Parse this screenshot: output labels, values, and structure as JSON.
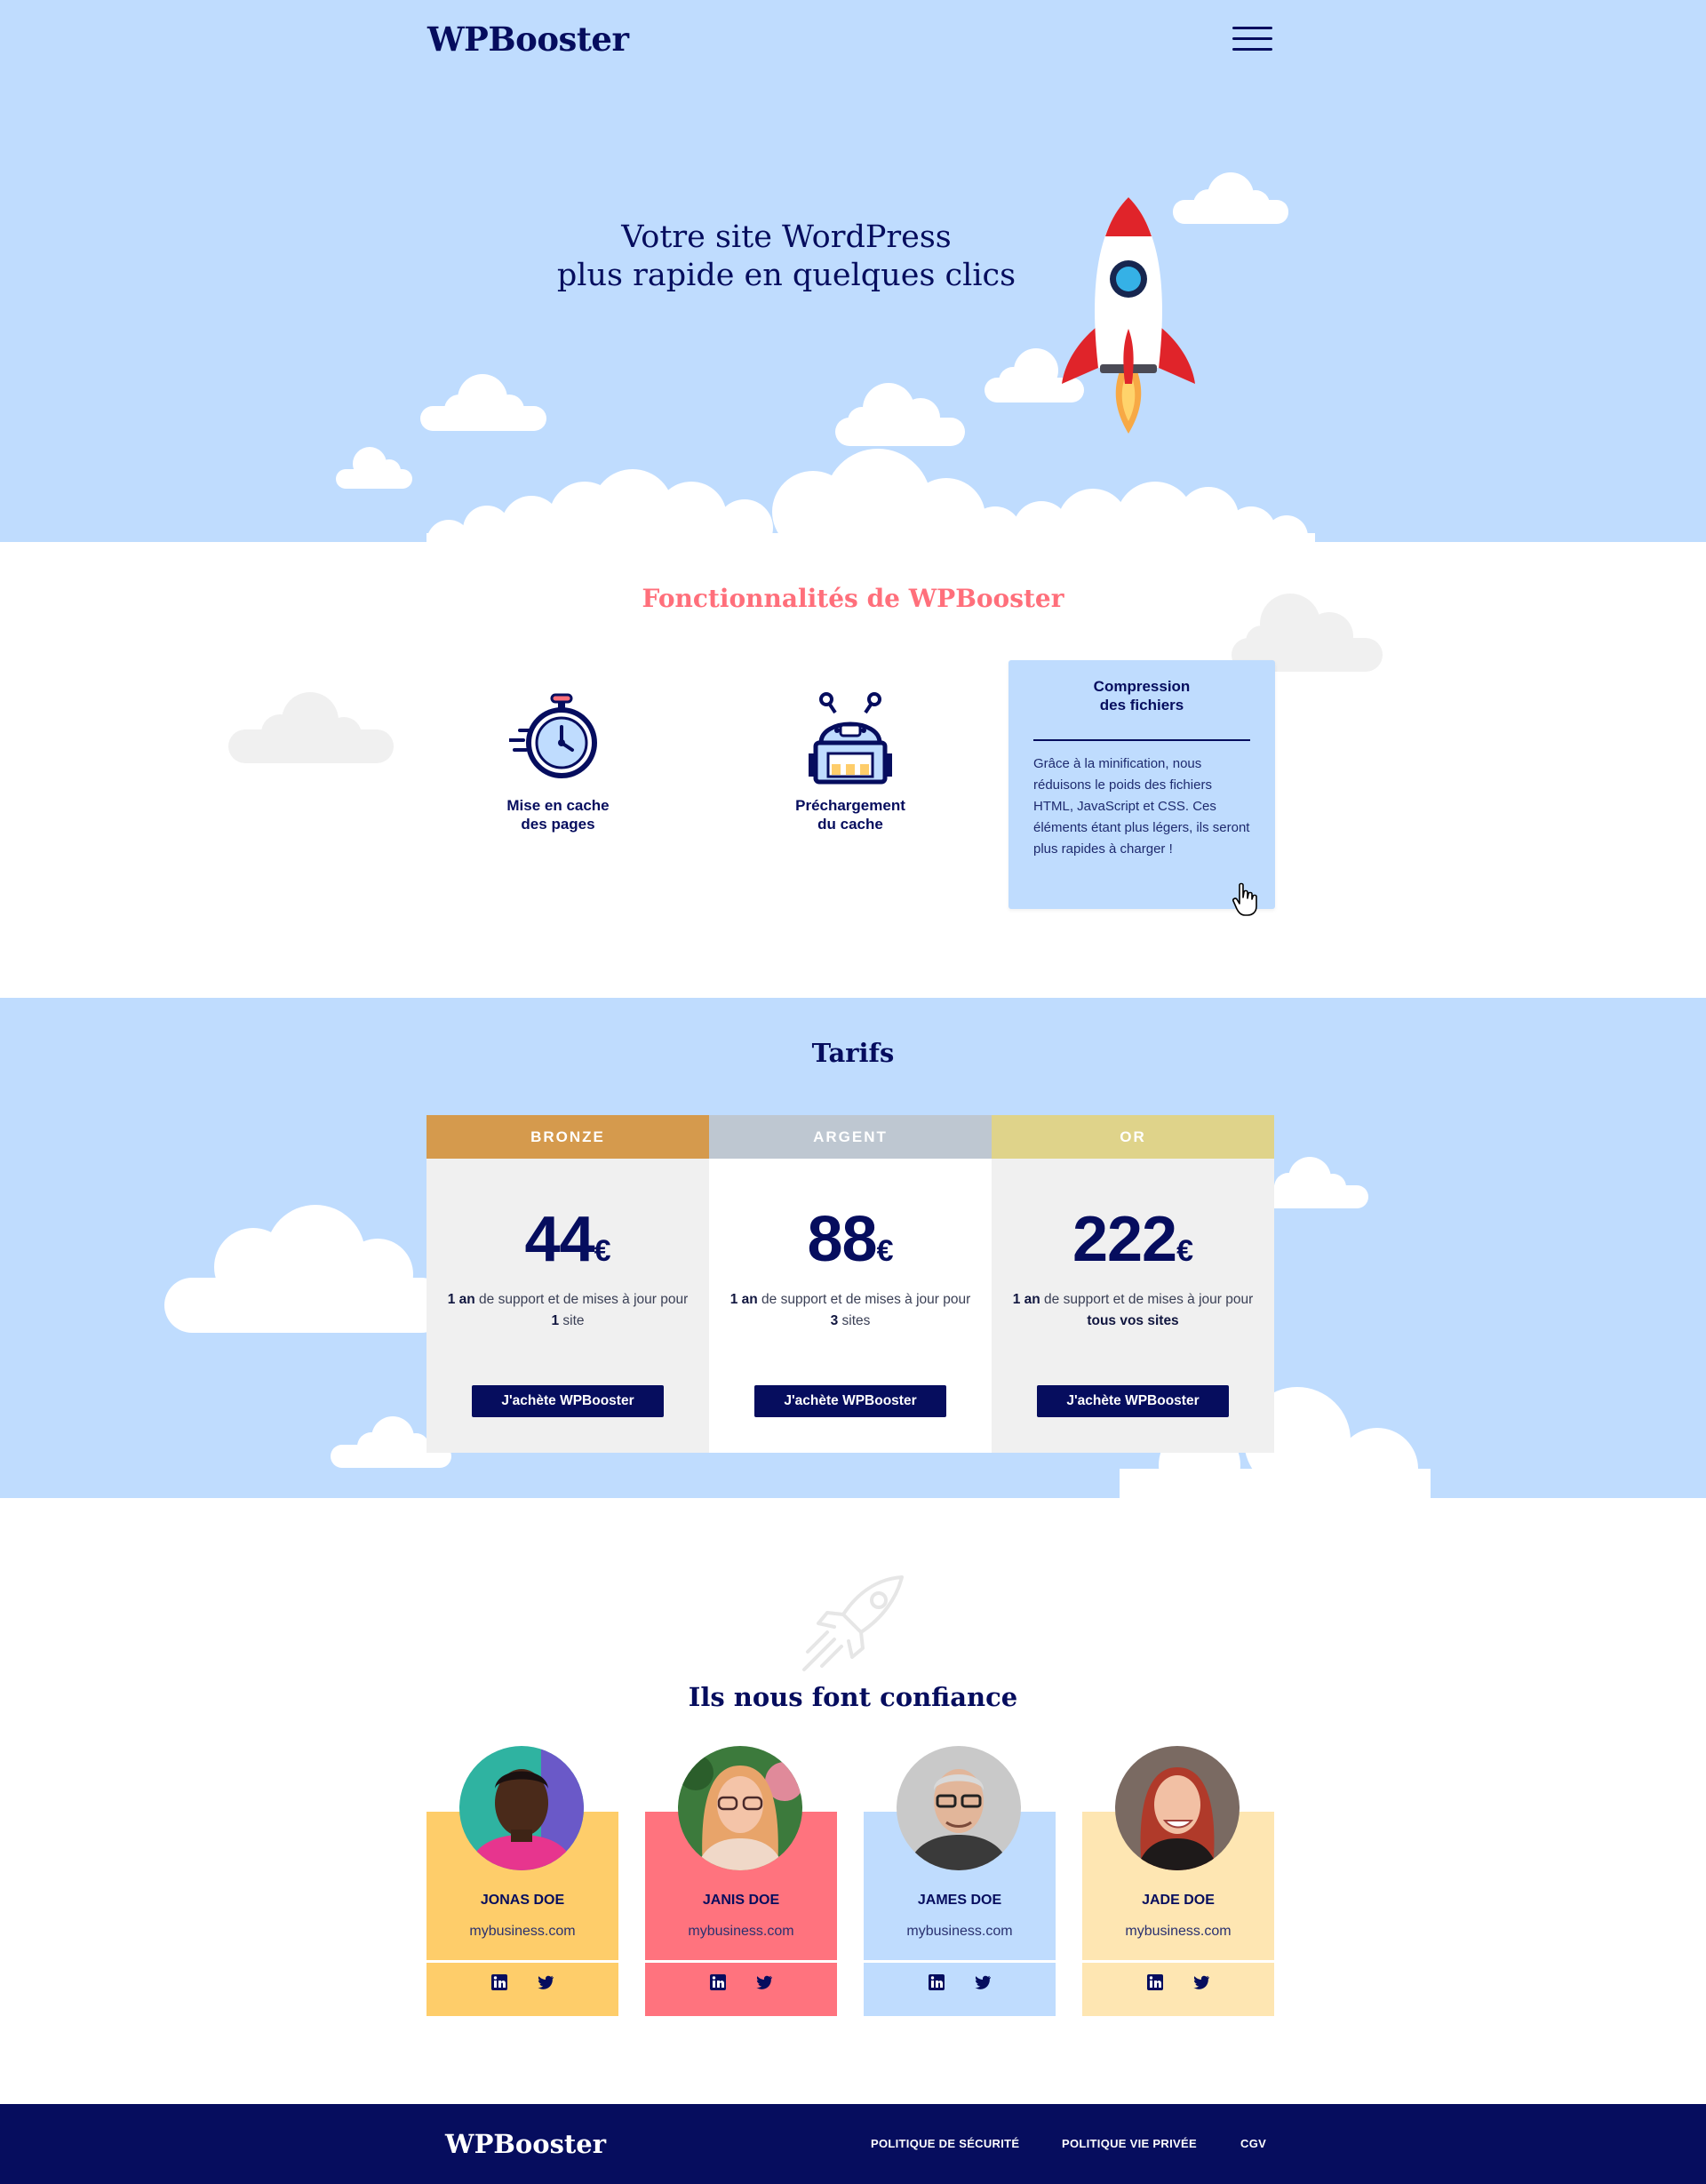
{
  "header": {
    "logo": "WPBooster",
    "menu_icon": "hamburger-menu-icon"
  },
  "hero": {
    "title_line1": "Votre site WordPress",
    "title_line2": "plus rapide en quelques clics",
    "illustration": "rocket-icon"
  },
  "features": {
    "title": "Fonctionnalités de WPBooster",
    "items": [
      {
        "icon": "stopwatch-icon",
        "label": "Mise en cache\ndes pages"
      },
      {
        "icon": "robot-icon",
        "label": "Préchargement\ndu cache"
      }
    ],
    "card": {
      "title": "Compression\ndes fichiers",
      "text": "Grâce à la minification, nous réduisons le poids des fichiers HTML, JavaScript et CSS. Ces éléments étant plus légers, ils seront plus rapides à charger !"
    }
  },
  "pricing": {
    "title": "Tarifs",
    "currency": "€",
    "plans": [
      {
        "name": "BRONZE",
        "price": "44",
        "desc_bold1": "1 an",
        "desc_mid": " de support et de mises à jour pour ",
        "desc_bold2": "1",
        "desc_end": " site",
        "button": "J'achète WPBooster",
        "head_color": "#d59a4d",
        "body_color": "#f0f0f0"
      },
      {
        "name": "ARGENT",
        "price": "88",
        "desc_bold1": "1 an",
        "desc_mid": " de support et de mises à jour pour ",
        "desc_bold2": "3",
        "desc_end": " sites",
        "button": "J'achète WPBooster",
        "head_color": "#bec7d1",
        "body_color": "#ffffff"
      },
      {
        "name": "OR",
        "price": "222",
        "desc_bold1": "1 an",
        "desc_mid": " de support et de mises à jour pour ",
        "desc_bold2": "tous vos sites",
        "desc_end": "",
        "button": "J'achète WPBooster",
        "head_color": "#dfd38a",
        "body_color": "#f0f0f0"
      }
    ]
  },
  "testimonials": {
    "title": "Ils nous font confiance",
    "people": [
      {
        "name": "JONAS DOE",
        "site": "mybusiness.com",
        "color": "#fecd6a"
      },
      {
        "name": "JANIS DOE",
        "site": "mybusiness.com",
        "color": "#ff737e"
      },
      {
        "name": "JAMES DOE",
        "site": "mybusiness.com",
        "color": "#bfdcfe"
      },
      {
        "name": "JADE DOE",
        "site": "mybusiness.com",
        "color": "#fee6b2"
      }
    ]
  },
  "footer": {
    "logo": "WPBooster",
    "links": [
      "POLITIQUE DE SÉCURITÉ",
      "POLITIQUE VIE PRIVÉE",
      "CGV"
    ]
  },
  "colors": {
    "navy": "#060d5e",
    "sky": "#bfdcfe",
    "coral": "#ff6f7b"
  }
}
